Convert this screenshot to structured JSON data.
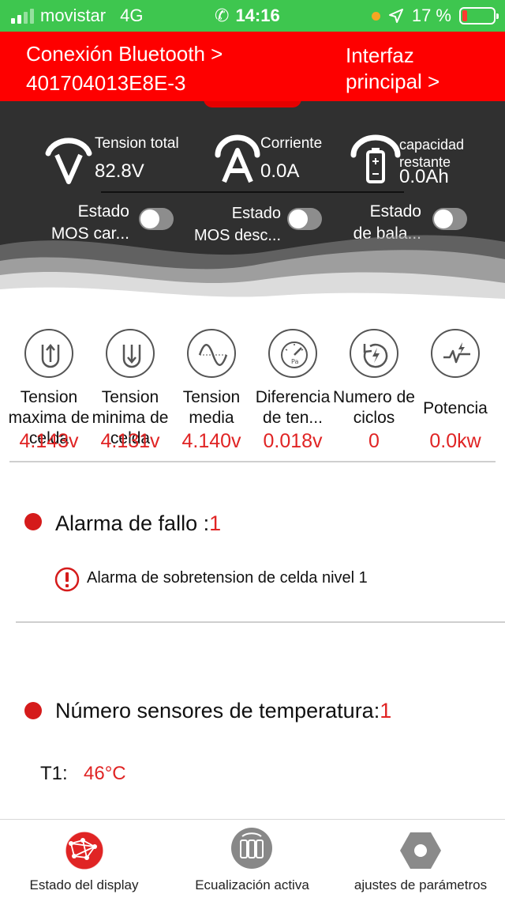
{
  "status_bar": {
    "carrier": "movistar",
    "network": "4G",
    "time": "14:16",
    "battery_text": "17 %",
    "battery_level": 0.17,
    "battery_color": "#ff3b30",
    "bar_color": "#3ec64f"
  },
  "header": {
    "bluetooth_line1": "Conexión Bluetooth >",
    "bluetooth_line2": "401704013E8E-3",
    "main_line1": "Interfaz",
    "main_line2": "principal >",
    "bg_color": "#fe0000"
  },
  "summary": {
    "voltage": {
      "icon": "volt-gauge-icon",
      "label": "Tension total",
      "value": "82.8V"
    },
    "current": {
      "icon": "amp-gauge-icon",
      "label": "Corriente",
      "value": "0.0A"
    },
    "capacity": {
      "icon": "battery-gauge-icon",
      "label_line1": "capacidad",
      "label_line2": "restante",
      "value": "0.0Ah"
    }
  },
  "toggles": [
    {
      "line1": "Estado",
      "line2": "MOS car...",
      "on": false
    },
    {
      "line1": "Estado",
      "line2": "MOS desc...",
      "on": false
    },
    {
      "line1": "Estado",
      "line2": "de bala...",
      "on": false
    }
  ],
  "cells": [
    {
      "icon": "arrow-up-u-icon",
      "label": "Tension maxima de celda",
      "value": "4.143v"
    },
    {
      "icon": "arrow-down-u-icon",
      "label": "Tension minima de celda",
      "value": "4.131v"
    },
    {
      "icon": "sine-wave-icon",
      "label": "Tension media",
      "value": "4.140v"
    },
    {
      "icon": "pressure-gauge-icon",
      "label": "Diferencia de ten...",
      "value": "0.018v"
    },
    {
      "icon": "cycle-bolt-icon",
      "label": "Numero de ciclos",
      "value": "0"
    },
    {
      "icon": "power-pulse-icon",
      "label": "Potencia",
      "value": "0.0kw"
    }
  ],
  "fault": {
    "title": "Alarma de fallo :",
    "count": "1",
    "items": [
      "Alarma de sobretension de celda nivel 1"
    ]
  },
  "temperature": {
    "title": "Número sensores de temperatura:",
    "count": "1",
    "sensors": [
      {
        "label": "T1:",
        "value": "46°C"
      }
    ]
  },
  "tabbar": [
    {
      "icon": "globe-network-icon",
      "label": "Estado del display",
      "active": true
    },
    {
      "icon": "cells-balance-icon",
      "label": "Ecualización activa",
      "active": false
    },
    {
      "icon": "hex-nut-icon",
      "label": "ajustes de parámetros",
      "active": false
    }
  ],
  "colors": {
    "accent_red": "#e02424",
    "dark_panel": "#303030"
  }
}
